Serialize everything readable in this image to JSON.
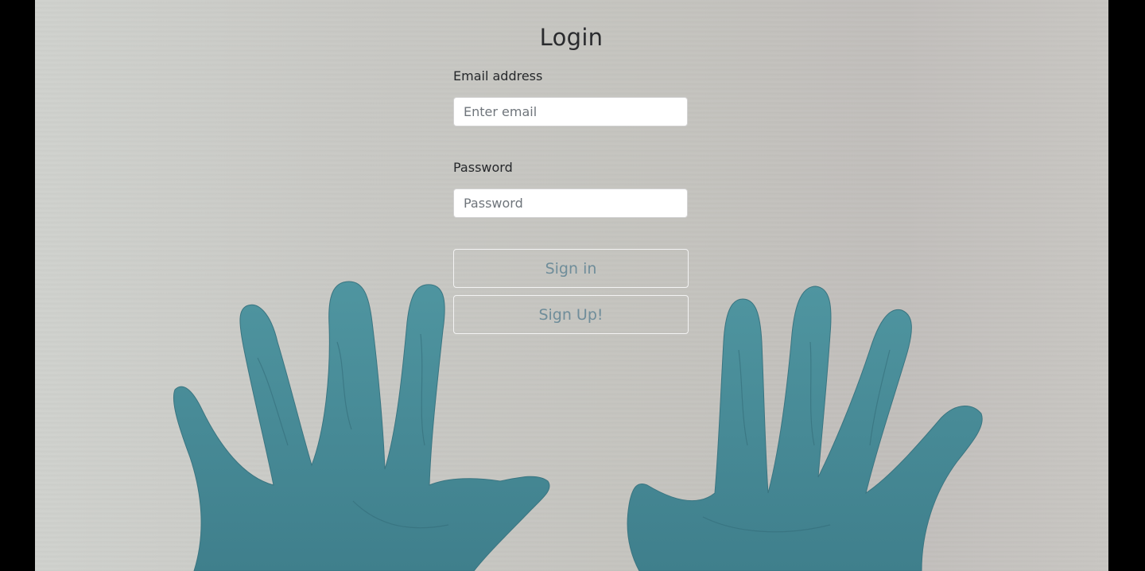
{
  "login": {
    "title": "Login",
    "email_label": "Email address",
    "email_placeholder": "Enter email",
    "email_value": "",
    "password_label": "Password",
    "password_placeholder": "Password",
    "password_value": "",
    "signin_label": "Sign in",
    "signup_label": "Sign Up!"
  },
  "colors": {
    "page_margin": "#000000",
    "background": "#c6c5c1",
    "glove": "#4f8d98",
    "button_text": "#6f8d9a",
    "title_text": "#2a2b2e"
  },
  "background_image": {
    "icon": "gloved-hands-image"
  }
}
